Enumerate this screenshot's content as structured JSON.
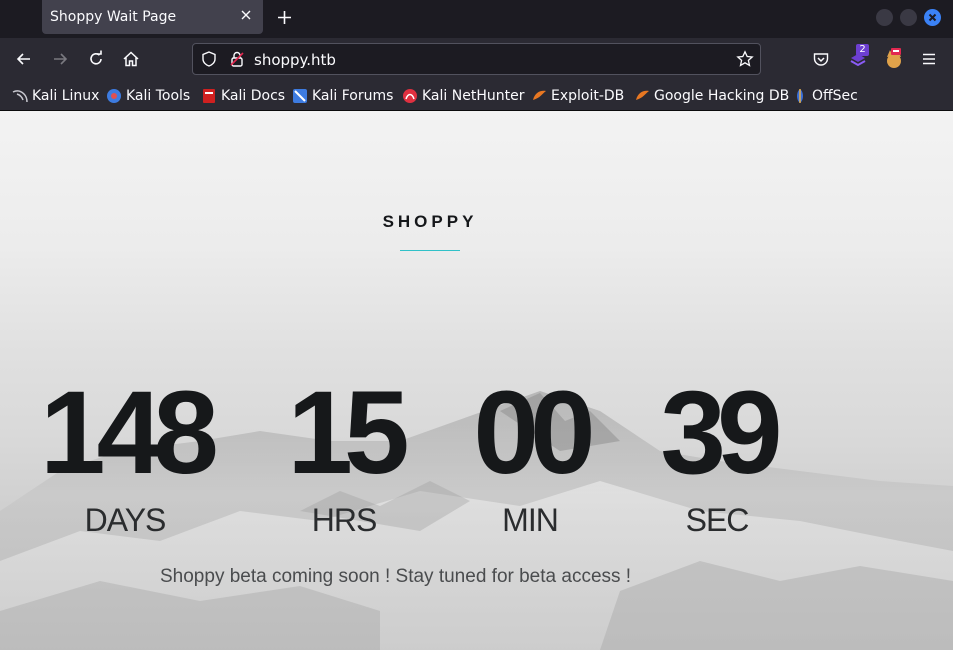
{
  "browser": {
    "tab": {
      "title": "Shoppy Wait Page"
    },
    "address_bar": {
      "url": "shoppy.htb"
    },
    "extension_badge": "2",
    "icons": {
      "back": "arrow-left-icon",
      "forward": "arrow-right-icon",
      "reload": "reload-icon",
      "home": "home-icon",
      "shield": "tracking-protection-icon",
      "lock": "insecure-lock-icon",
      "star": "bookmark-star-icon",
      "pocket": "pocket-icon",
      "menu": "hamburger-menu-icon"
    },
    "colors": {
      "chrome_dark": "#1c1b22",
      "toolbar": "#2b2a33",
      "tab_active": "#42414d",
      "accent": "#3b82f6"
    }
  },
  "bookmarks": [
    {
      "label": "Kali Linux",
      "icon": "kali-dragon-icon"
    },
    {
      "label": "Kali Tools",
      "icon": "kali-tools-icon"
    },
    {
      "label": "Kali Docs",
      "icon": "kali-docs-icon"
    },
    {
      "label": "Kali Forums",
      "icon": "kali-forums-icon"
    },
    {
      "label": "Kali NetHunter",
      "icon": "nethunter-icon"
    },
    {
      "label": "Exploit-DB",
      "icon": "exploit-db-icon"
    },
    {
      "label": "Google Hacking DB",
      "icon": "ghdb-icon"
    },
    {
      "label": "OffSec",
      "icon": "offsec-icon"
    }
  ],
  "page": {
    "site_title": "SHOPPY",
    "countdown": [
      {
        "value": "148",
        "unit": "DAYS"
      },
      {
        "value": "15",
        "unit": "HRS"
      },
      {
        "value": "00",
        "unit": "MIN"
      },
      {
        "value": "39",
        "unit": "SEC"
      }
    ],
    "tagline": "Shoppy beta coming soon ! Stay tuned for beta access !",
    "colors": {
      "title_rule": "#31c1c8",
      "digits": "#16181a"
    }
  }
}
